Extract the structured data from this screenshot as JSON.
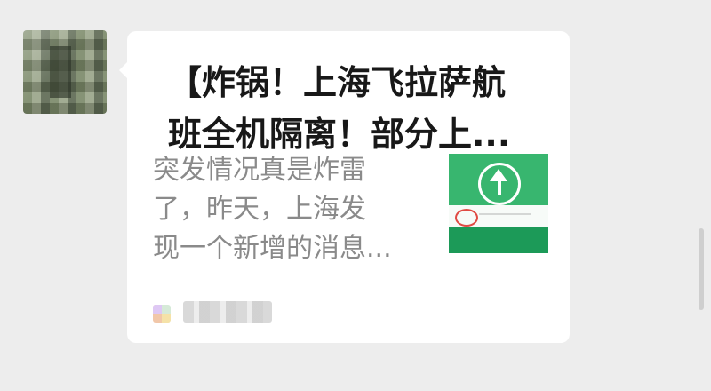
{
  "message": {
    "title": "【炸锅！上海飞拉萨航\n班全机隔离！部分上...",
    "summary": "突发情况真是炸雷\n了，昨天，上海发\n现一个新增的消息..."
  }
}
